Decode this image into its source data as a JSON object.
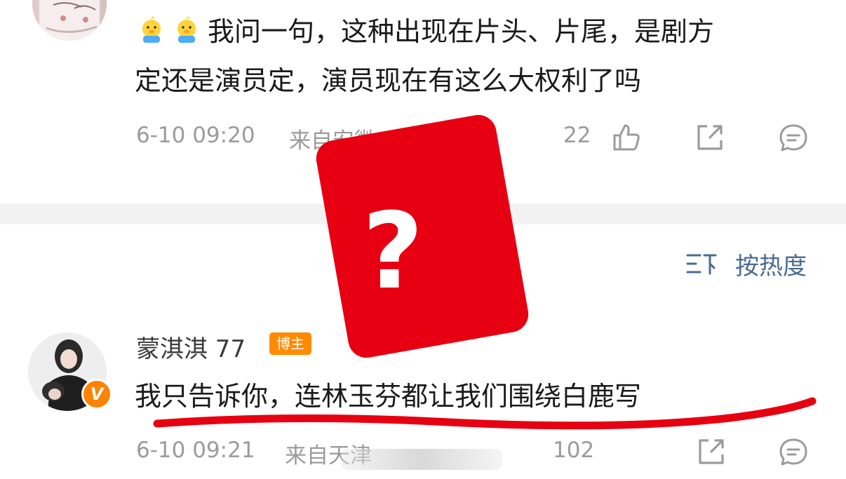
{
  "comment1": {
    "emoji_name": "chick-emoji",
    "text_line1": "我问一句，这种出现在片头、片尾，是剧方",
    "text_line2": "定还是演员定，演员现在有这么大权利了吗",
    "time": "6-10 09:20",
    "location": "来自安徽",
    "likes": "22"
  },
  "sort": {
    "label": "按热度",
    "icon": "sort-icon"
  },
  "comment2": {
    "username": "蒙淇淇 77",
    "badge": "博主",
    "verified_mark": "V",
    "text": "我只告诉你，连林玉芬都让我们围绕白鹿写",
    "time": "6-10 09:21",
    "location": "来自天津",
    "likes": "102"
  },
  "overlay": {
    "question_mark": "?",
    "card_color": "#e60012",
    "underline_color": "#e60012"
  },
  "colors": {
    "meta_gray": "#9b9b9b",
    "link_blue": "#4a6b90",
    "badge_orange": "#ff8a00"
  }
}
